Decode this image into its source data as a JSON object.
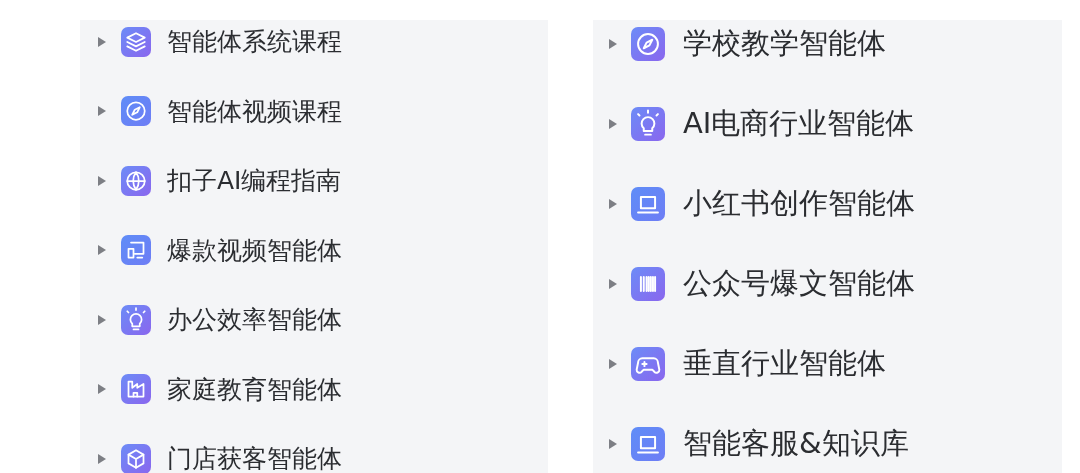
{
  "panels": [
    {
      "items": [
        {
          "label": "智能体系统课程",
          "expanded": false,
          "kind": "layers"
        },
        {
          "label": "智能体视频课程",
          "expanded": false,
          "kind": "compass"
        },
        {
          "label": "扣子AI编程指南",
          "expanded": false,
          "kind": "globe"
        },
        {
          "label": "爆款视频智能体",
          "expanded": false,
          "kind": "monitor"
        },
        {
          "label": "办公效率智能体",
          "expanded": false,
          "kind": "bulb"
        },
        {
          "label": "家庭教育智能体",
          "expanded": false,
          "kind": "factory"
        },
        {
          "label": "门店获客智能体",
          "expanded": false,
          "kind": "cube"
        }
      ]
    },
    {
      "items": [
        {
          "label": "学校教学智能体",
          "expanded": false,
          "kind": "compass"
        },
        {
          "label": "AI电商行业智能体",
          "expanded": false,
          "kind": "bulb"
        },
        {
          "label": "小红书创作智能体",
          "expanded": false,
          "kind": "laptop"
        },
        {
          "label": "公众号爆文智能体",
          "expanded": false,
          "kind": "barcode"
        },
        {
          "label": "垂直行业智能体",
          "expanded": false,
          "kind": "gamepad"
        },
        {
          "label": "智能客服&知识库",
          "expanded": false,
          "kind": "laptop"
        }
      ]
    }
  ]
}
